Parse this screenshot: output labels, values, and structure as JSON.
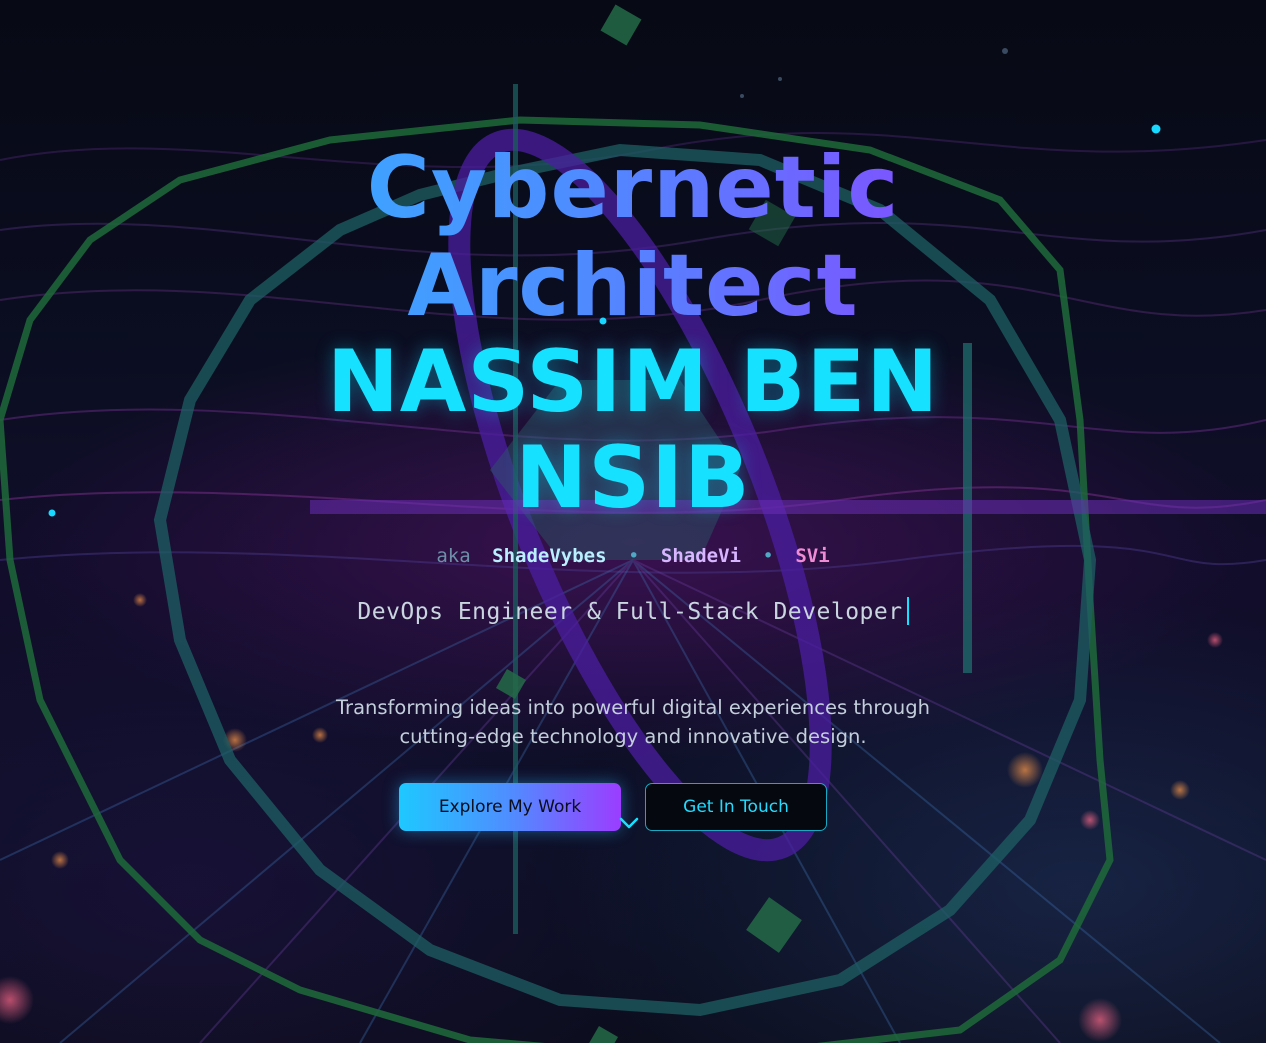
{
  "hero": {
    "title_line_1": "Cybernetic",
    "title_line_2": "Architect",
    "name_line_1": "NASSIM BEN",
    "name_line_2": "NSIB",
    "aka_prefix": "aka",
    "aliases": [
      "ShadeVybes",
      "ShadeVi",
      "SVi"
    ],
    "alias_separator": "•",
    "role": "DevOps Engineer & Full-Stack Developer",
    "tagline_line_1": "Transforming ideas into powerful digital experiences through",
    "tagline_line_2": "cutting-edge technology and innovative design."
  },
  "buttons": {
    "primary_label": "Explore My Work",
    "secondary_label": "Get In Touch"
  },
  "icons": {
    "scroll": "chevron-down-icon"
  },
  "colors": {
    "accent_cyan": "#16e1ff",
    "accent_purple": "#9b3dff",
    "gradient_start": "#27c6ff",
    "gradient_end": "#a83dff",
    "background": "#07091a"
  }
}
